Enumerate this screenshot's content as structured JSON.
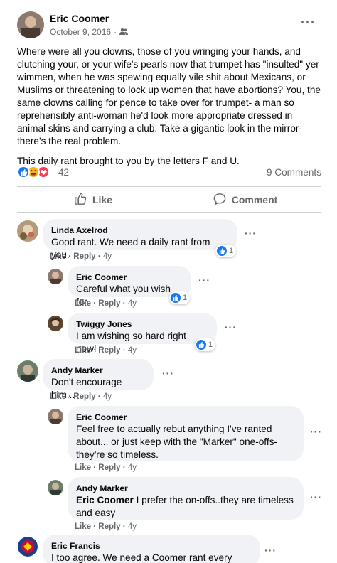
{
  "post": {
    "author": "Eric Coomer",
    "date": "October 9, 2016",
    "date_separator": "·",
    "audience_icon": "friends-icon",
    "more_icon": "more-horizontal-icon",
    "more_label": "···",
    "paragraph1": "Where were all you clowns, those of you wringing your hands, and clutching your, or your wife's pearls now that trumpet has \"insulted\" yer wimmen, when he was spewing equally vile shit about Mexicans, or Muslims or threatening to lock up women that have abortions? You, the same clowns calling for pence to take over for trumpet- a man so reprehensibly anti-woman he'd look more appropriate dressed in animal skins and carrying a club. Take a gigantic look in the mirror- there's the real problem.",
    "paragraph2": "This daily rant brought to you by the letters F and U.",
    "reaction_count": "42",
    "comments_count": "9 Comments",
    "reactions": [
      "like",
      "haha",
      "love"
    ],
    "like_label": "Like",
    "comment_label": "Comment"
  },
  "labels": {
    "like": "Like",
    "reply": "Reply",
    "sep": "·",
    "more": "···"
  },
  "comments": [
    {
      "name": "Linda Axelrod",
      "text": "Good rant. We need a daily rant from you.",
      "time": "4y",
      "likes": "1"
    },
    {
      "name": "Eric Coomer",
      "text": "Careful what you wish for",
      "time": "4y",
      "likes": "1"
    },
    {
      "name": "Twiggy Jones",
      "text": "I am wishing so hard right now!",
      "time": "4y",
      "likes": "1"
    },
    {
      "name": "Andy Marker",
      "text": "Don't encourage him...",
      "time": "4y"
    },
    {
      "name": "Eric Coomer",
      "line1": "Feel free to actually rebut anything I've ranted",
      "line2": "about... or just keep with the \"Marker\" one-offs-",
      "line3": "they're so timeless.",
      "time": "4y"
    },
    {
      "name": "Andy Marker",
      "mention": "Eric Coomer",
      "line1": " I prefer the on-offs..they are timeless",
      "line2": "and easy",
      "time": "4y"
    },
    {
      "name": "Eric Francis",
      "text": "I too agree. We need a Coomer rant every day."
    }
  ],
  "colors": {
    "accent": "#1877f2",
    "bubble": "#f0f2f5",
    "muted": "#65676b"
  }
}
